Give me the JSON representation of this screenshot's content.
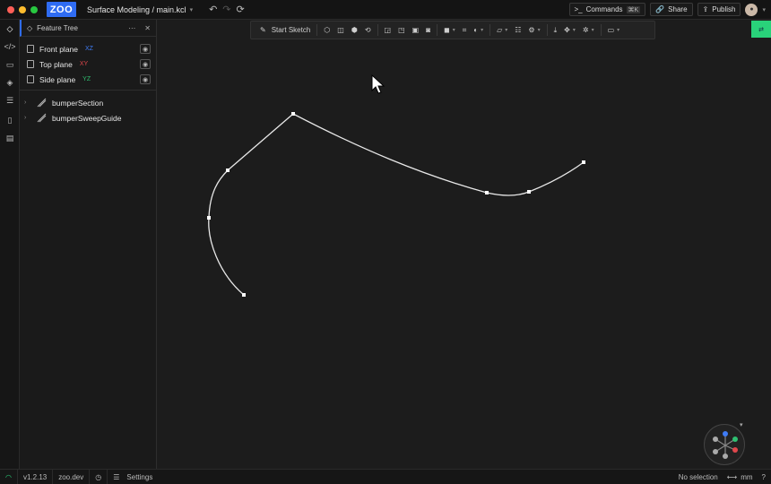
{
  "titlebar": {
    "project_path": "Surface Modeling / main.kcl",
    "logo": "ZOO",
    "commands_label": "Commands",
    "commands_shortcut": "⌘K",
    "share_label": "Share",
    "publish_label": "Publish"
  },
  "feature_tree": {
    "title": "Feature Tree",
    "planes": [
      {
        "label": "Front plane",
        "axis": "XZ",
        "axis_color": "#3f7cf6"
      },
      {
        "label": "Top plane",
        "axis": "XY",
        "axis_color": "#e0474c"
      },
      {
        "label": "Side plane",
        "axis": "YZ",
        "axis_color": "#2fbf71"
      }
    ],
    "items": [
      {
        "label": "bumperSection"
      },
      {
        "label": "bumperSweepGuide"
      }
    ]
  },
  "toolbar": {
    "start_sketch_label": "Start Sketch"
  },
  "statusbar": {
    "version": "v1.2.13",
    "site": "zoo.dev",
    "settings_label": "Settings",
    "selection": "No selection",
    "units": "mm",
    "help": "?"
  },
  "colors": {
    "accent": "#2f6cf3",
    "green_tab": "#29d27a",
    "background": "#1c1c1c"
  }
}
